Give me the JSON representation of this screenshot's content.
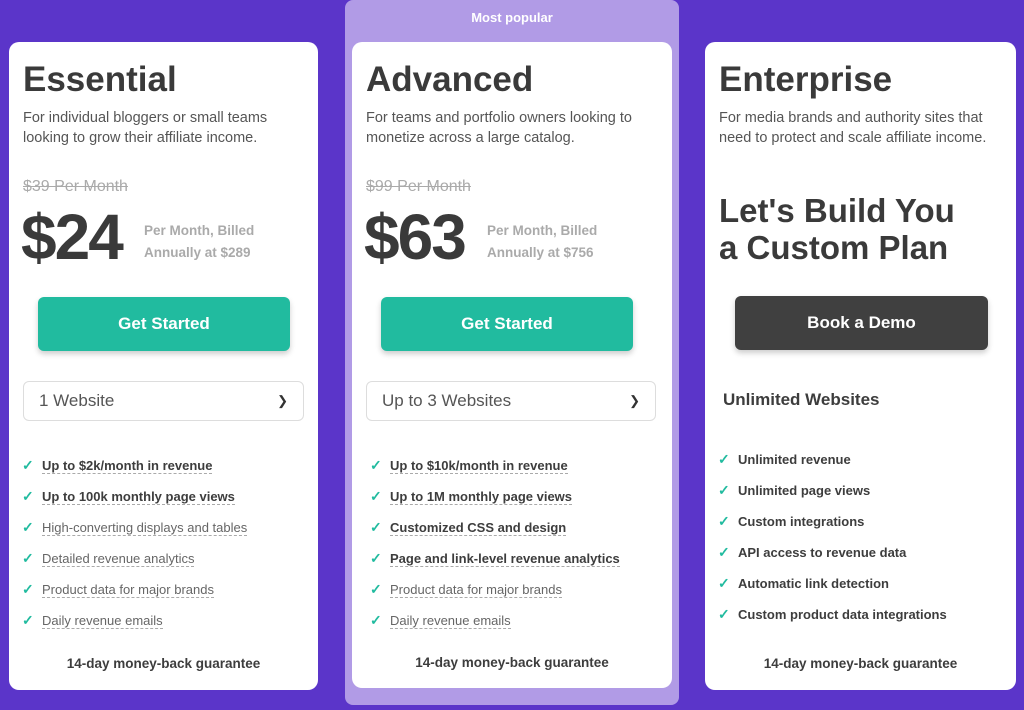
{
  "colors": {
    "background": "#5b35c9",
    "accent": "#21bb9f",
    "popular_band": "#b19be6",
    "dark_button": "#404040"
  },
  "popular_label": "Most popular",
  "plans": [
    {
      "name": "Essential",
      "description": "For individual bloggers or small teams looking to grow their affiliate income.",
      "old_price": "$39 Per Month",
      "price": "$24",
      "price_note_1": "Per Month, Billed",
      "price_note_2": "Annually at $289",
      "button": "Get Started",
      "select": "1 Website",
      "features": [
        {
          "text": "Up to $2k/month in revenue",
          "bold": true
        },
        {
          "text": "Up to 100k monthly page views",
          "bold": true
        },
        {
          "text": "High-converting displays and tables",
          "bold": false
        },
        {
          "text": "Detailed revenue analytics",
          "bold": false
        },
        {
          "text": "Product data for major brands",
          "bold": false
        },
        {
          "text": "Daily revenue emails",
          "bold": false
        }
      ],
      "guarantee": "14-day money-back guarantee"
    },
    {
      "name": "Advanced",
      "description": "For teams and portfolio owners looking to monetize across a large catalog.",
      "old_price": "$99 Per Month",
      "price": "$63",
      "price_note_1": "Per Month, Billed",
      "price_note_2": "Annually at $756",
      "button": "Get Started",
      "select": "Up to 3 Websites",
      "features": [
        {
          "text": "Up to $10k/month in revenue",
          "bold": true
        },
        {
          "text": "Up to 1M monthly page views",
          "bold": true
        },
        {
          "text": "Customized CSS and design",
          "bold": true
        },
        {
          "text": "Page and link-level revenue analytics",
          "bold": true
        },
        {
          "text": "Product data for major brands",
          "bold": false
        },
        {
          "text": "Daily revenue emails",
          "bold": false
        }
      ],
      "guarantee": "14-day money-back guarantee"
    },
    {
      "name": "Enterprise",
      "description": "For media brands and authority sites that need to protect and scale affiliate income.",
      "headline_1": "Let's Build You",
      "headline_2": "a Custom Plan",
      "button": "Book a Demo",
      "websites": "Unlimited Websites",
      "features": [
        {
          "text": "Unlimited revenue",
          "bold": true
        },
        {
          "text": "Unlimited page views",
          "bold": true
        },
        {
          "text": "Custom integrations",
          "bold": true
        },
        {
          "text": "API access to revenue data",
          "bold": true
        },
        {
          "text": "Automatic link detection",
          "bold": true
        },
        {
          "text": "Custom product data integrations",
          "bold": true
        }
      ],
      "guarantee": "14-day money-back guarantee"
    }
  ]
}
